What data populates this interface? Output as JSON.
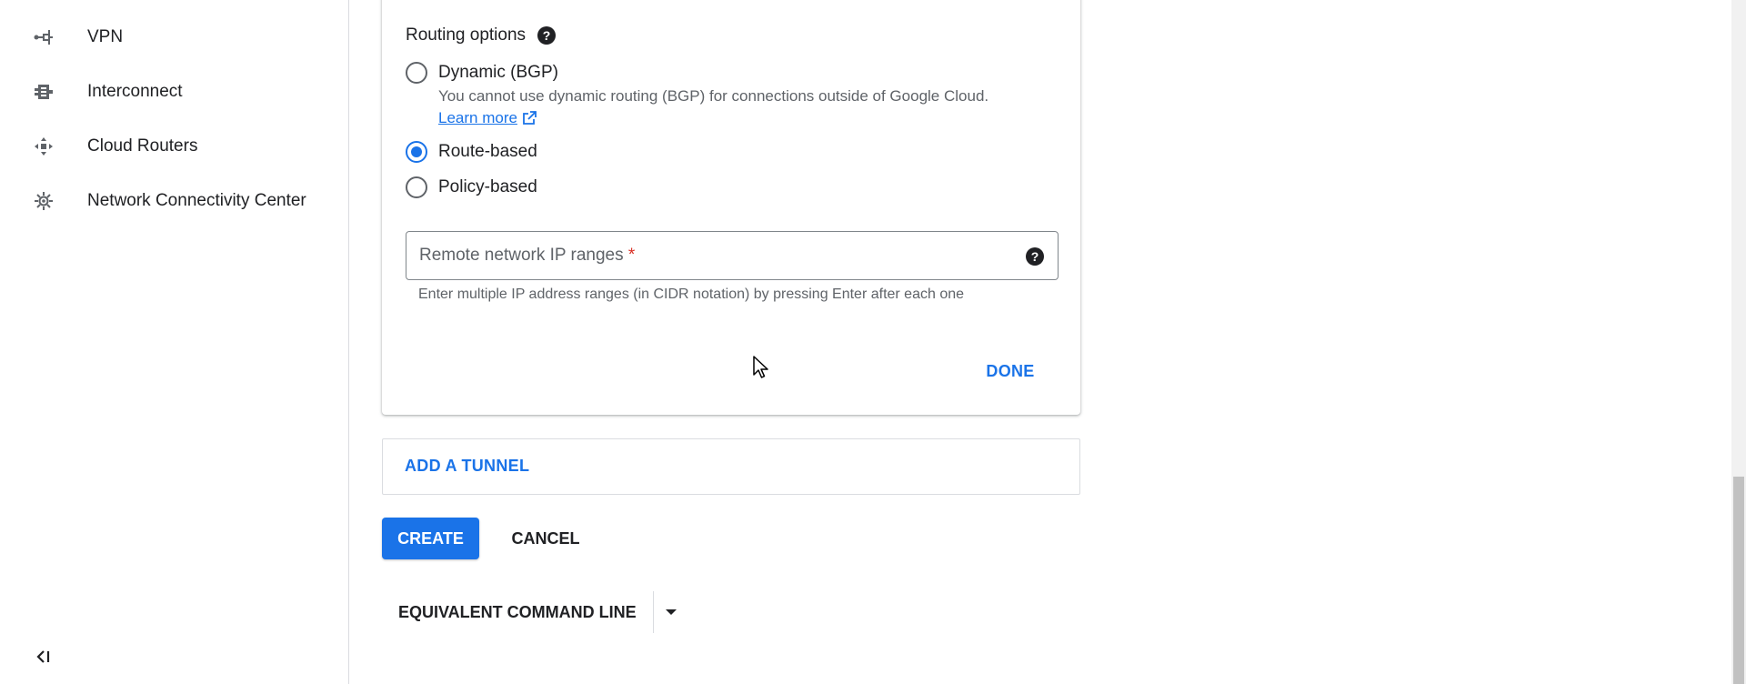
{
  "sidebar": {
    "items": [
      {
        "label": "VPN",
        "icon": "vpn-icon"
      },
      {
        "label": "Interconnect",
        "icon": "interconnect-icon"
      },
      {
        "label": "Cloud Routers",
        "icon": "cloud-routers-icon"
      },
      {
        "label": "Network Connectivity Center",
        "icon": "network-connectivity-center-icon"
      }
    ],
    "collapse_icon": "collapse-sidebar-icon"
  },
  "routing": {
    "title": "Routing options",
    "options": [
      {
        "label": "Dynamic (BGP)",
        "checked": false
      },
      {
        "label": "Route-based",
        "checked": true
      },
      {
        "label": "Policy-based",
        "checked": false
      }
    ],
    "bgp_description": "You cannot use dynamic routing (BGP) for connections outside of Google Cloud.",
    "learn_more": "Learn more"
  },
  "remote_ranges": {
    "placeholder": "Remote network IP ranges",
    "required_marker": "*",
    "hint": "Enter multiple IP address ranges (in CIDR notation) by pressing Enter after each one"
  },
  "actions": {
    "done": "DONE",
    "add_tunnel": "ADD A TUNNEL",
    "create": "CREATE",
    "cancel": "CANCEL",
    "equivalent_command_line": "EQUIVALENT COMMAND LINE"
  },
  "colors": {
    "accent": "#1a73e8",
    "text": "#202124",
    "secondary_text": "#5f6368",
    "required": "#d93025",
    "border": "#dadce0"
  }
}
